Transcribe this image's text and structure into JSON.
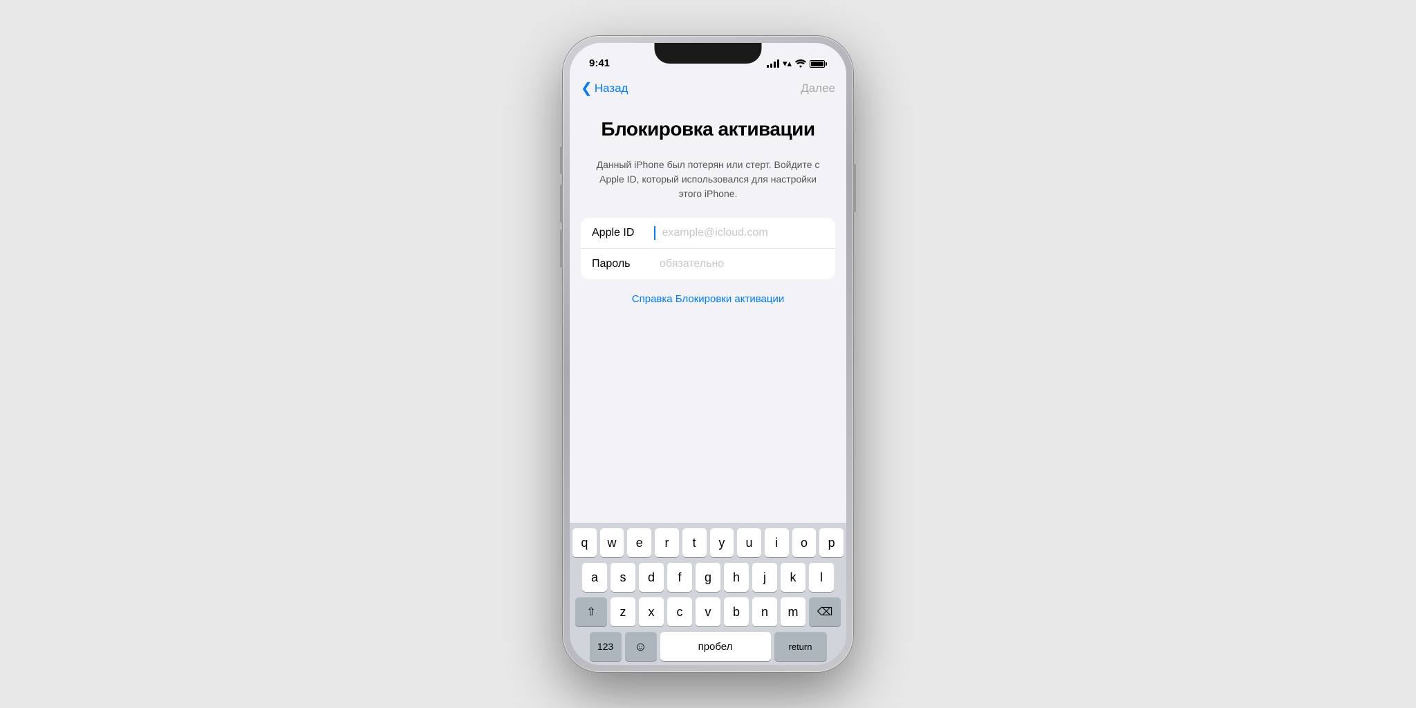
{
  "phone": {
    "status_bar": {
      "time": "9:41",
      "signal_label": "signal",
      "wifi_label": "wifi",
      "battery_label": "battery"
    },
    "nav": {
      "back_label": "Назад",
      "next_label": "Далее"
    },
    "title": "Блокировка активации",
    "description": "Данный iPhone был потерян или стерт. Войдите с Apple ID, который использовался для настройки этого iPhone.",
    "form": {
      "apple_id_label": "Apple ID",
      "apple_id_placeholder": "example@icloud.com",
      "password_label": "Пароль",
      "password_placeholder": "обязательно"
    },
    "help_link": "Справка Блокировки активации",
    "keyboard": {
      "row1": [
        "q",
        "w",
        "e",
        "r",
        "t",
        "y",
        "u",
        "i",
        "o",
        "p"
      ],
      "row2": [
        "a",
        "s",
        "d",
        "f",
        "g",
        "h",
        "j",
        "k",
        "l"
      ],
      "row3_special_left": "⇧",
      "row3_keys": [
        "z",
        "x",
        "c",
        "v",
        "b",
        "n",
        "m"
      ],
      "row3_special_right": "⌫",
      "numbers_label": "123",
      "emoji_label": "☺",
      "space_label": "пробел",
      "return_label": "return"
    }
  }
}
